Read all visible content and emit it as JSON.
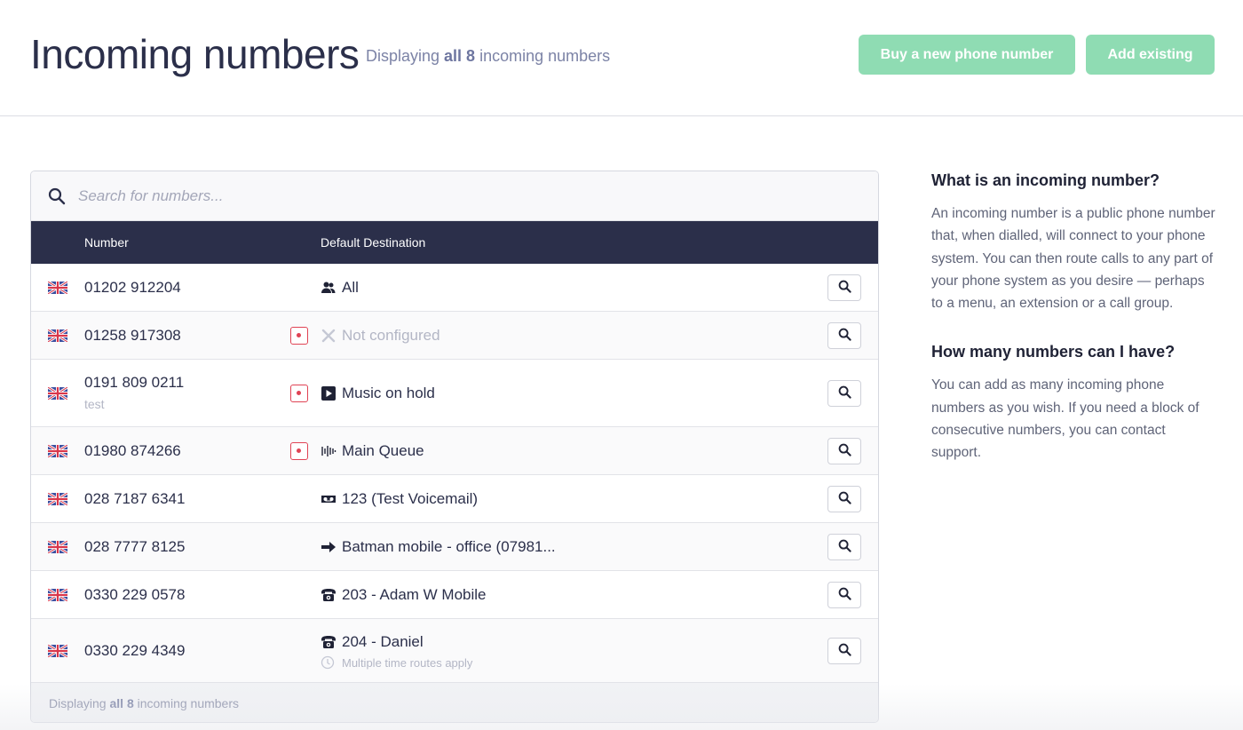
{
  "header": {
    "title": "Incoming numbers",
    "subtitle_prefix": "Displaying ",
    "subtitle_bold": "all 8",
    "subtitle_suffix": " incoming numbers",
    "buy_button": "Buy a new phone number",
    "add_button": "Add existing"
  },
  "search": {
    "placeholder": "Search for numbers..."
  },
  "table": {
    "columns": [
      "Number",
      "Default Destination"
    ],
    "rows": [
      {
        "number": "01202 912204",
        "note": "",
        "recording": false,
        "dest_icon": "users-icon",
        "destination": "All",
        "dest_note": ""
      },
      {
        "number": "01258 917308",
        "note": "",
        "recording": true,
        "dest_icon": "x-icon",
        "destination": "Not configured",
        "dest_note": ""
      },
      {
        "number": "0191 809 0211",
        "note": "test",
        "recording": true,
        "dest_icon": "play-icon",
        "destination": "Music on hold",
        "dest_note": ""
      },
      {
        "number": "01980 874266",
        "note": "",
        "recording": true,
        "dest_icon": "queue-icon",
        "destination": "Main Queue",
        "dest_note": ""
      },
      {
        "number": "028 7187 6341",
        "note": "",
        "recording": false,
        "dest_icon": "voicemail-icon",
        "destination": "123 (Test Voicemail)",
        "dest_note": ""
      },
      {
        "number": "028 7777 8125",
        "note": "",
        "recording": false,
        "dest_icon": "arrow-right-icon",
        "destination": "Batman mobile - office (07981...",
        "dest_note": ""
      },
      {
        "number": "0330 229 0578",
        "note": "",
        "recording": false,
        "dest_icon": "phone-icon",
        "destination": "203 - Adam W Mobile",
        "dest_note": ""
      },
      {
        "number": "0330 229 4349",
        "note": "",
        "recording": false,
        "dest_icon": "phone-icon",
        "destination": "204 - Daniel",
        "dest_note": "Multiple time routes apply"
      }
    ]
  },
  "footer": {
    "prefix": "Displaying ",
    "bold": "all 8",
    "suffix": " incoming numbers"
  },
  "side": {
    "q1_title": "What is an incoming number?",
    "q1_body": "An incoming number is a public phone number that, when dialled, will connect to your phone system. You can then route calls to any part of your phone system as you desire — perhaps to a menu, an extension or a call group.",
    "q2_title": "How many numbers can I have?",
    "q2_body": "You can add as many incoming phone numbers as you wish. If you need a block of consecutive numbers, you can contact support."
  },
  "colors": {
    "navy": "#2b2f4a",
    "green": "#8fdcb3",
    "record_red": "#e04354",
    "muted": "#b3b6c5"
  }
}
